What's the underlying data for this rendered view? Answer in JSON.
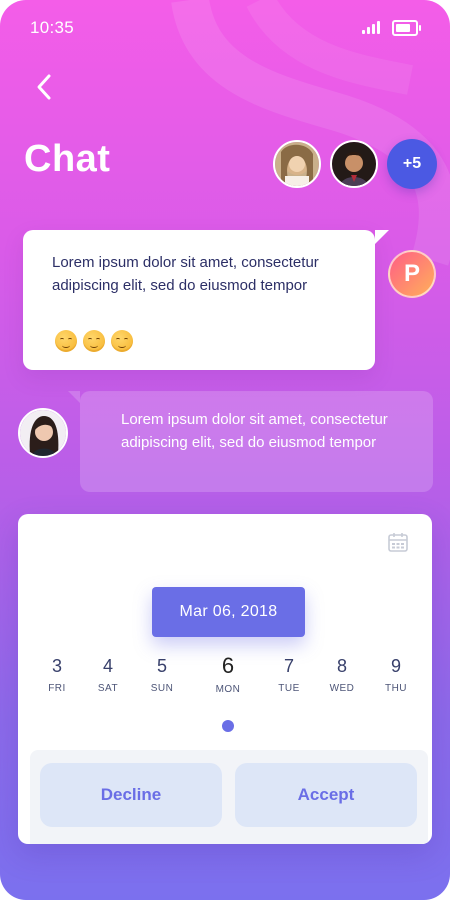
{
  "status": {
    "time": "10:35"
  },
  "header": {
    "title": "Chat",
    "more_count": "+5"
  },
  "messages": [
    {
      "text": "Lorem ipsum dolor sit amet, consectetur adipiscing elit, sed do eiusmod tempor",
      "avatar_initial": "P",
      "emojis": [
        "smiling-face",
        "smiling-face",
        "smiling-face"
      ]
    },
    {
      "text": "Lorem ipsum dolor sit amet, consectetur adipiscing elit, sed do eiusmod tempor"
    }
  ],
  "calendar": {
    "selected_date": "Mar 06, 2018",
    "days": [
      {
        "num": "3",
        "name": "FRI"
      },
      {
        "num": "4",
        "name": "SAT"
      },
      {
        "num": "5",
        "name": "SUN"
      },
      {
        "num": "6",
        "name": "MON",
        "active": true
      },
      {
        "num": "7",
        "name": "TUE"
      },
      {
        "num": "8",
        "name": "WED"
      },
      {
        "num": "9",
        "name": "THU"
      }
    ]
  },
  "actions": {
    "decline": "Decline",
    "accept": "Accept"
  },
  "colors": {
    "accent": "#6a6ee6",
    "more_badge": "#4b59e3",
    "gradient_top": "#f45de8",
    "gradient_bottom": "#7b70ee"
  }
}
